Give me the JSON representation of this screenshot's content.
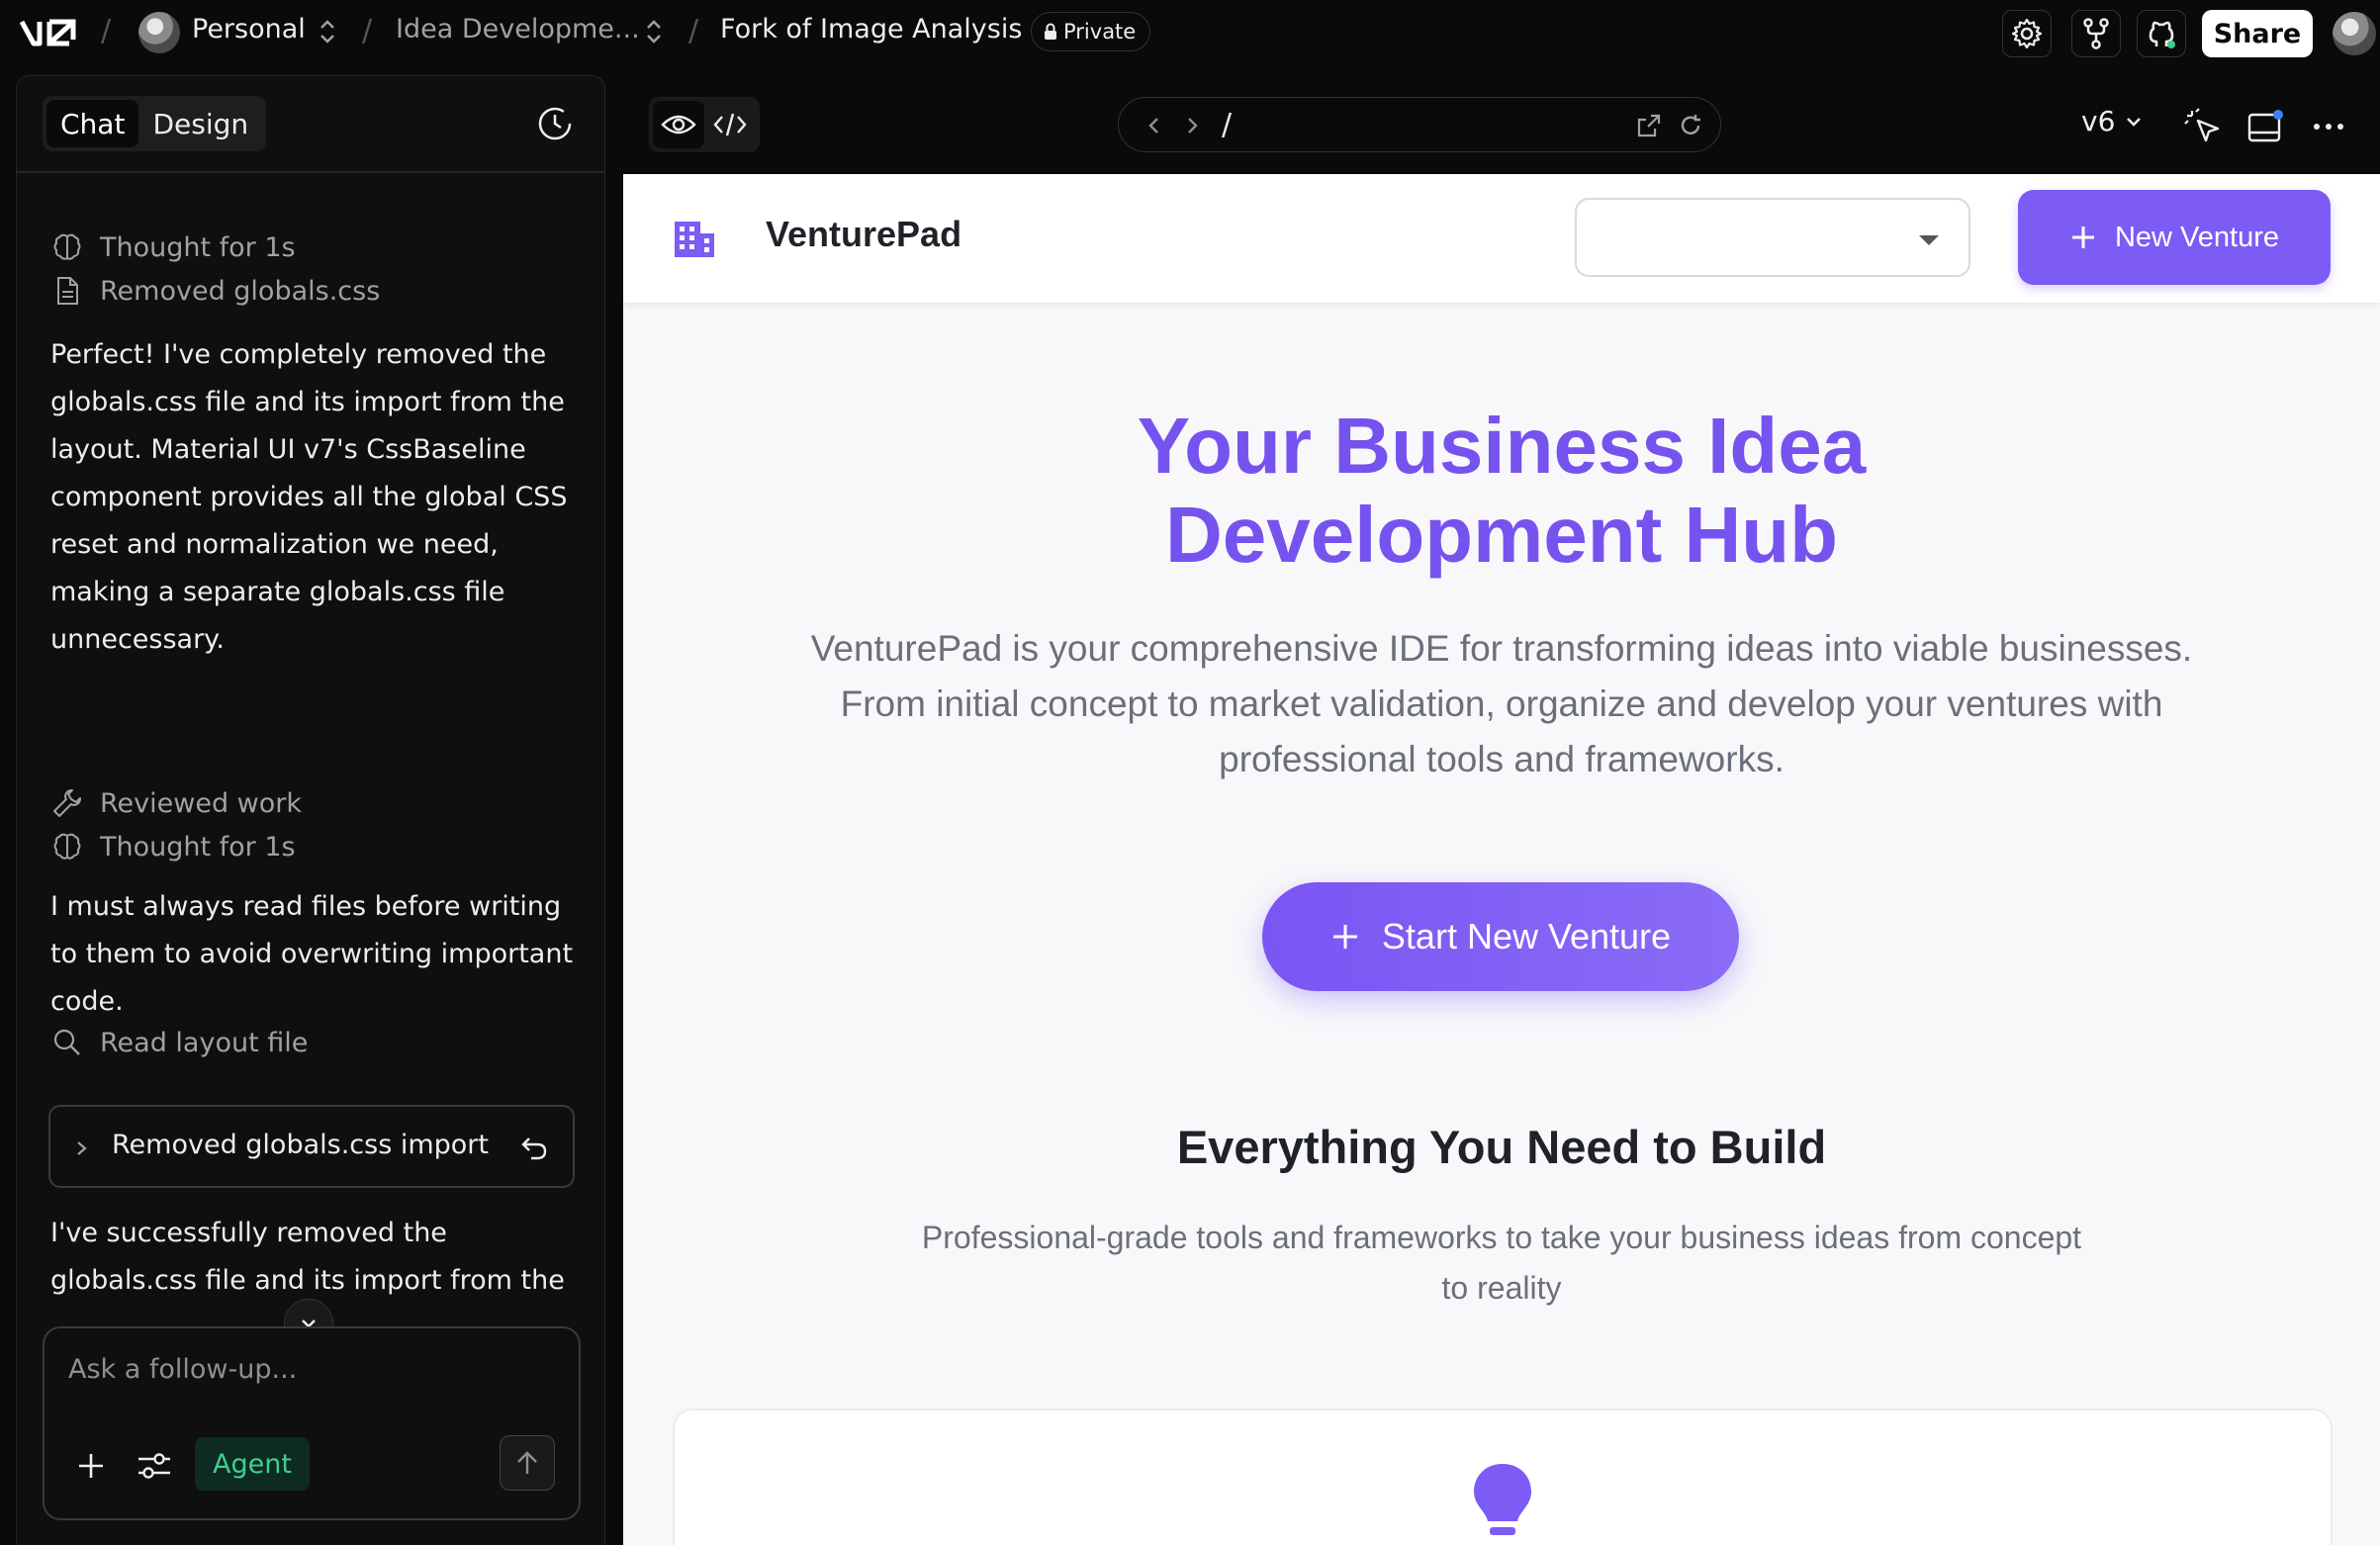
{
  "topbar": {
    "workspace": "Personal",
    "project": "Idea Developme...",
    "chat_title": "Fork of Image Analysis",
    "visibility": "Private",
    "share_label": "Share"
  },
  "left_panel": {
    "tabs": [
      "Chat",
      "Design"
    ],
    "steps": {
      "thought_1": "Thought for 1s",
      "removed_file": "Removed globals.css",
      "reviewed": "Reviewed work",
      "thought_2": "Thought for 1s",
      "read_layout": "Read layout file"
    },
    "message_1": "Perfect! I've completely removed the globals.css file and its import from the layout. Material UI v7's CssBaseline component provides all the global CSS reset and normalization we need, making a separate globals.css file unnecessary.",
    "message_2": "I must always read files before writing to them to avoid overwriting important code.",
    "fold_card_label": "Removed globals.css import",
    "message_3_line1": "I've successfully removed the",
    "message_3_line2": "globals.css file and its import from the",
    "composer": {
      "placeholder": "Ask a follow-up...",
      "mode": "Agent"
    }
  },
  "preview_toolbar": {
    "url_path": "/",
    "version": "v6"
  },
  "app": {
    "brand": "VenturePad",
    "new_venture_label": "New Venture",
    "hero_title_line1": "Your Business Idea",
    "hero_title_line2": "Development Hub",
    "hero_subtitle": "VenturePad is your comprehensive IDE for transforming ideas into viable businesses. From initial concept to market validation, organize and develop your ventures with professional tools and frameworks.",
    "start_label": "Start New Venture",
    "section_title": "Everything You Need to Build",
    "section_subtitle": "Professional-grade tools and frameworks to take your business ideas from concept to reality",
    "accent_color": "#7c5cf5"
  }
}
